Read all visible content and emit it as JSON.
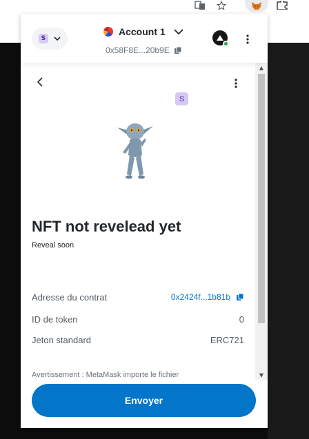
{
  "header": {
    "network_badge": "S",
    "account_name": "Account 1",
    "account_address": "0x58F8E...20b9E"
  },
  "nft": {
    "collection_badge": "S",
    "name": "NFT not revelead yet",
    "description": "Reveal soon",
    "image_description": "blue goblin-like creature"
  },
  "details": {
    "contract_label": "Adresse du contrat",
    "contract_value": "0x2424f...1b81b",
    "token_id_label": "ID de token",
    "token_id_value": "0",
    "standard_label": "Jeton standard",
    "standard_value": "ERC721"
  },
  "warning": "Avertissement : MetaMask importe le fichier",
  "footer": {
    "send_label": "Envoyer"
  },
  "colors": {
    "primary": "#0376c9",
    "text": "#24272a",
    "muted": "#535a61",
    "badge_bg": "#d6c9f5"
  },
  "icons": [
    "translate-icon",
    "star-icon",
    "metamask-fox-icon",
    "puzzle-icon",
    "chevron-down-icon",
    "copy-icon",
    "connected-site-icon",
    "kebab-menu-icon",
    "back-arrow-icon"
  ]
}
